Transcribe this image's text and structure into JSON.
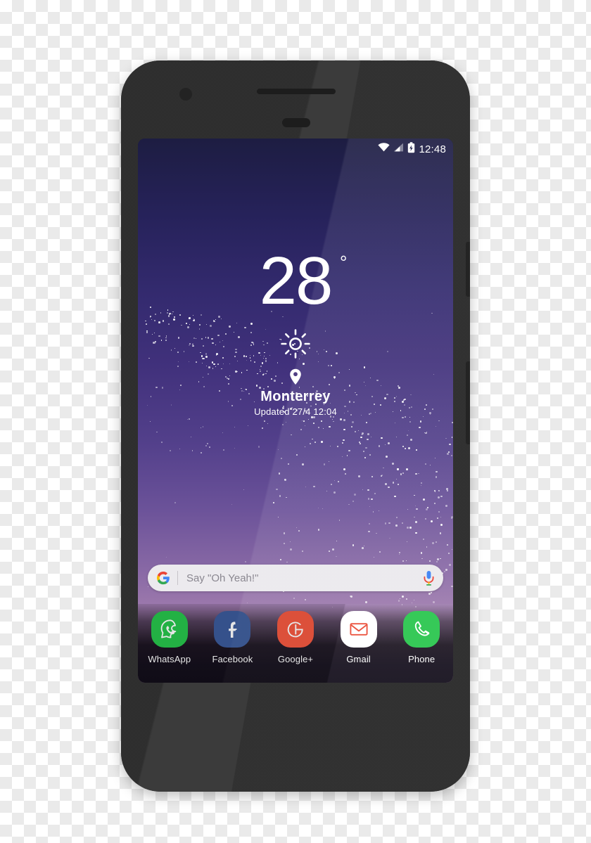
{
  "device": {
    "name": "android-smartphone-mockup",
    "body_color": "#2e2e2e",
    "hardware": {
      "front_camera": "camera-icon",
      "earpiece": "earpiece-speaker",
      "proximity_sensor": "proximity-sensor",
      "power_button": "power-button",
      "volume_button": "volume-button"
    }
  },
  "statusbar": {
    "wifi_icon": "wifi-icon",
    "signal_icon": "signal-bars-icon",
    "battery_icon": "battery-charging-icon",
    "clock": "12:48"
  },
  "weather": {
    "temperature": "28",
    "degree_symbol": "°",
    "condition_icon": "sun-icon",
    "location_icon": "location-pin-icon",
    "city": "Monterrey",
    "updated": "Updated 27/4  12:04"
  },
  "search": {
    "logo_icon": "google-g-icon",
    "placeholder": "Say \"Oh Yeah!\"",
    "mic_icon": "google-mic-icon",
    "bar_color": "#eceaee"
  },
  "dock": {
    "apps": [
      {
        "label": "WhatsApp",
        "icon": "whatsapp-icon",
        "color": "#27c54c",
        "glyph_color": "#ffffff"
      },
      {
        "label": "Facebook",
        "icon": "facebook-icon",
        "color": "#3b5a9b",
        "glyph_color": "#ffffff"
      },
      {
        "label": "Google+",
        "icon": "google-plus-icon",
        "color": "#f4533b",
        "glyph_color": "#ffffff"
      },
      {
        "label": "Gmail",
        "icon": "gmail-icon",
        "color": "#ffffff",
        "glyph_color": "#ea4a35"
      },
      {
        "label": "Phone",
        "icon": "phone-icon",
        "color": "#27c54c",
        "glyph_color": "#ffffff"
      }
    ]
  },
  "wallpaper": {
    "name": "night-sky-gradient-wallpaper",
    "top_color": "#1d1d42",
    "mid_color": "#53408b",
    "bottom_color": "#b98fb4"
  },
  "background": {
    "name": "transparency-checkerboard",
    "light": "#ffffff",
    "dark": "#eaeaea"
  }
}
